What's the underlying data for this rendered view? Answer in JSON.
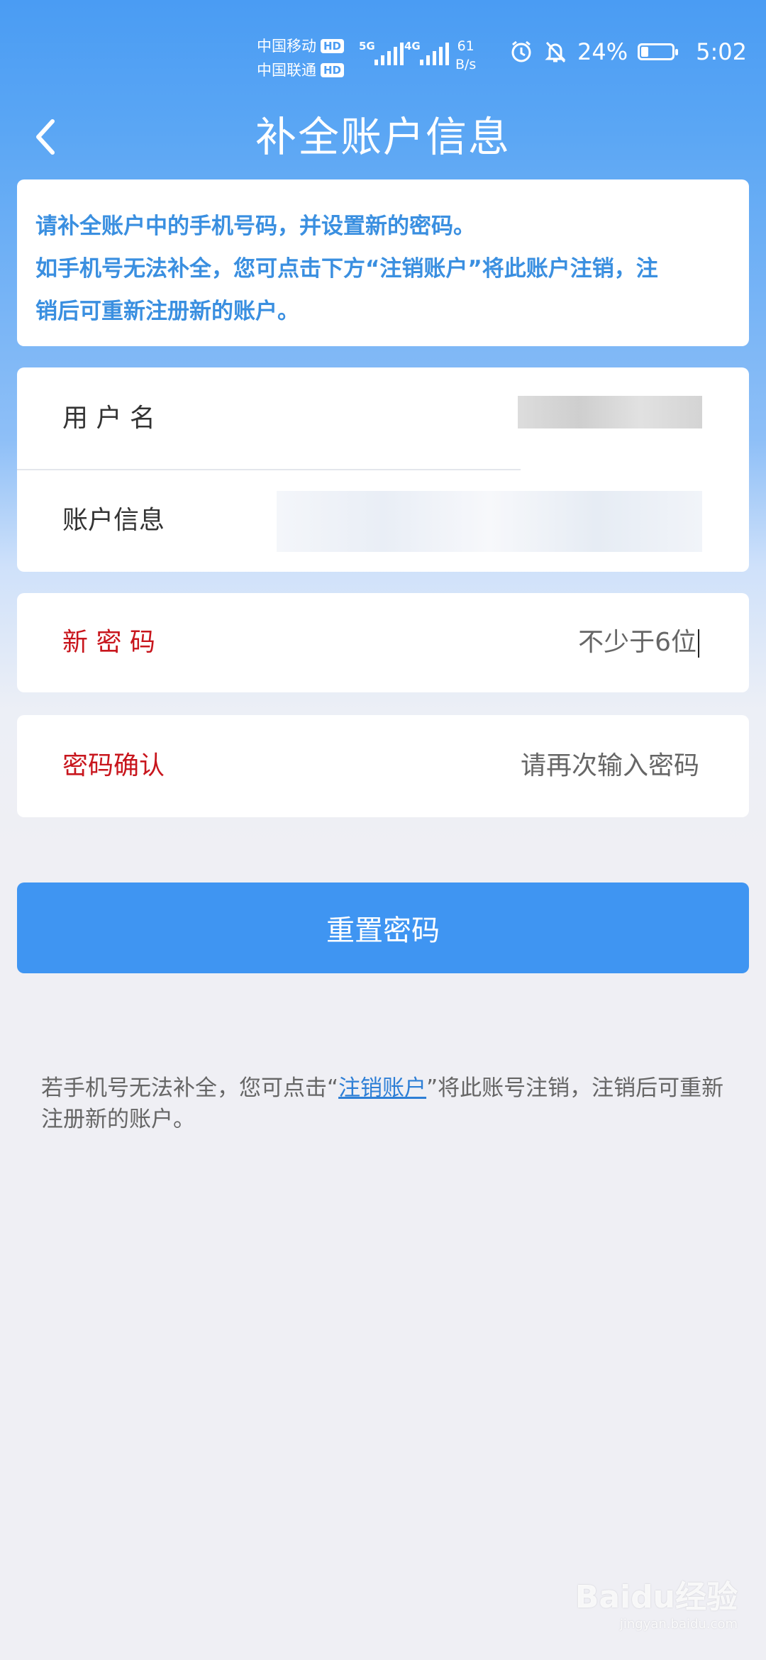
{
  "status_bar": {
    "carrier_1": "中国移动",
    "carrier_2": "中国联通",
    "hd": "HD",
    "net_1": "5G",
    "net_2": "4G",
    "speed_value": "61",
    "speed_unit": "B/s",
    "battery_percent": "24%",
    "battery_level": 0.24,
    "time": "5:02",
    "icons": [
      "alarm-icon",
      "bell-off-icon",
      "battery-icon"
    ]
  },
  "header": {
    "title": "补全账户信息",
    "back_icon": "chevron-left-icon"
  },
  "notice": {
    "line_1": "请补全账户中的手机号码，并设置新的密码。",
    "line_2": "如手机号无法补全，您可点击下方“注销账户”将此账户注销，注",
    "line_3": "销后可重新注册新的账户。"
  },
  "account": {
    "username_label": "用 户 名",
    "account_info_label": "账户信息"
  },
  "new_password": {
    "label": "新 密 码",
    "placeholder": "不少于6位"
  },
  "confirm_password": {
    "label": "密码确认",
    "placeholder": "请再次输入密码"
  },
  "reset_button": "重置密码",
  "footnote": {
    "before": "若手机号无法补全，您可点击“",
    "link": "注销账户",
    "after": "”将此账号注销，注销后可重新注册新的账户。"
  },
  "watermark": {
    "brand": "Baidu经验",
    "url": "jingyan.baidu.com"
  },
  "colors": {
    "primary": "#3f95f2",
    "notice_text": "#3a8fe0",
    "label_red": "#c8161d",
    "background": "#efeff4"
  }
}
